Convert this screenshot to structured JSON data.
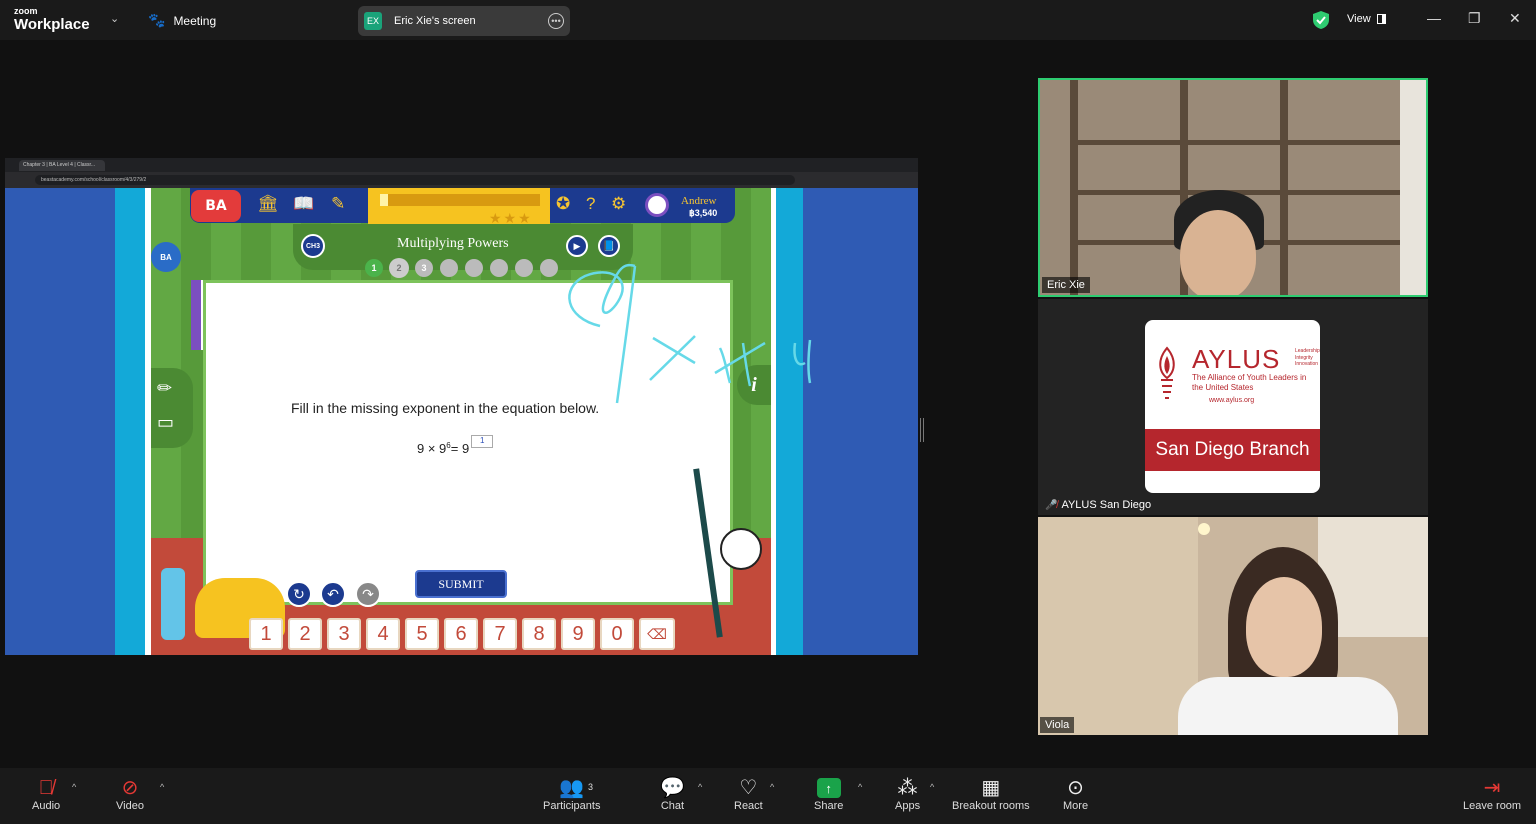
{
  "app": {
    "brand_top": "zoom",
    "brand_bottom": "Workplace",
    "meeting_label": "Meeting"
  },
  "screen_share": {
    "badge": "EX",
    "label": "Eric Xie's screen"
  },
  "topright": {
    "view_label": "View"
  },
  "browser": {
    "tab_title": "Chapter 3 | BA Level 4 | Classr...",
    "url": "beastacademy.com/school/classroom/4/3/279/2"
  },
  "game": {
    "logo": "BA",
    "progress_fraction": 0.05,
    "stars": "★★★",
    "user_name": "Andrew",
    "user_coins": "฿3,540",
    "chapter_badge": "CH3",
    "lesson_title": "Multiplying Powers",
    "progress_dots": [
      "1",
      "2",
      "3",
      "",
      "",
      "",
      "",
      ""
    ],
    "question": "Fill in the missing exponent in the equation below.",
    "equation_base": "9 × 9",
    "equation_exp": "6",
    "equation_rhs": " = 9",
    "answer_exp": "1",
    "submit_label": "SUBMIT",
    "info_label": "i",
    "keys": [
      "1",
      "2",
      "3",
      "4",
      "5",
      "6",
      "7",
      "8",
      "9",
      "0"
    ],
    "annotation": "1 x 9 x 4"
  },
  "participants": [
    {
      "name": "Eric Xie",
      "muted": false
    },
    {
      "name": "AYLUS San Diego",
      "muted": true
    },
    {
      "name": "Viola",
      "muted": false
    }
  ],
  "aylus_card": {
    "name": "AYLUS",
    "tagline": "Leadership Integrity Innovation",
    "subtitle": "The Alliance of Youth Leaders in the United States",
    "url": "www.aylus.org",
    "branch": "San Diego Branch"
  },
  "toolbar": {
    "audio": "Audio",
    "video": "Video",
    "participants": "Participants",
    "participants_count": "3",
    "chat": "Chat",
    "react": "React",
    "share": "Share",
    "apps": "Apps",
    "breakout": "Breakout rooms",
    "more": "More",
    "leave": "Leave room"
  },
  "colors": {
    "accent_green": "#2ecc71",
    "share_green": "#1aa34a",
    "aylus_red": "#b5262d",
    "game_blue": "#1c3a8f"
  }
}
